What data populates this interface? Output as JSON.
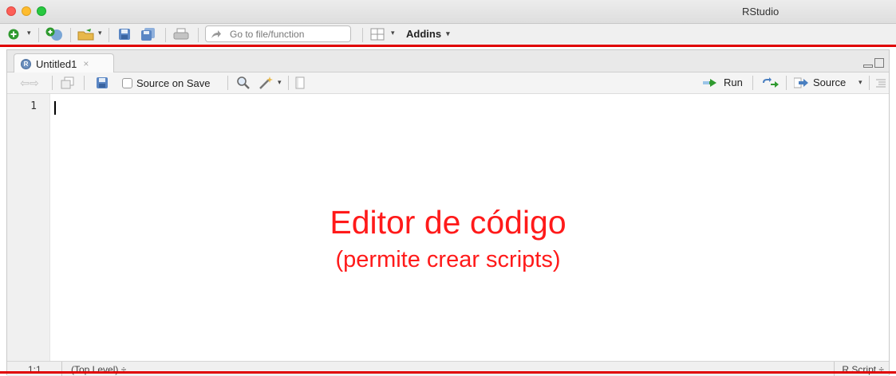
{
  "window": {
    "title": "RStudio"
  },
  "main_toolbar": {
    "goto_placeholder": "Go to file/function",
    "addins_label": "Addins"
  },
  "editor": {
    "tab_label": "Untitled1",
    "tab_close": "×",
    "r_badge": "R",
    "toolbar": {
      "source_on_save": "Source on Save",
      "run": "Run",
      "source": "Source"
    },
    "line_numbers": [
      "1"
    ],
    "annotation": {
      "title": "Editor de código",
      "subtitle": "(permite crear scripts)"
    },
    "status": {
      "position": "1:1",
      "scope": "(Top Level) ÷",
      "file_type": "R Script ÷"
    }
  },
  "colors": {
    "annotation_red": "#ff1a1a",
    "highlight_line": "#e00000"
  }
}
